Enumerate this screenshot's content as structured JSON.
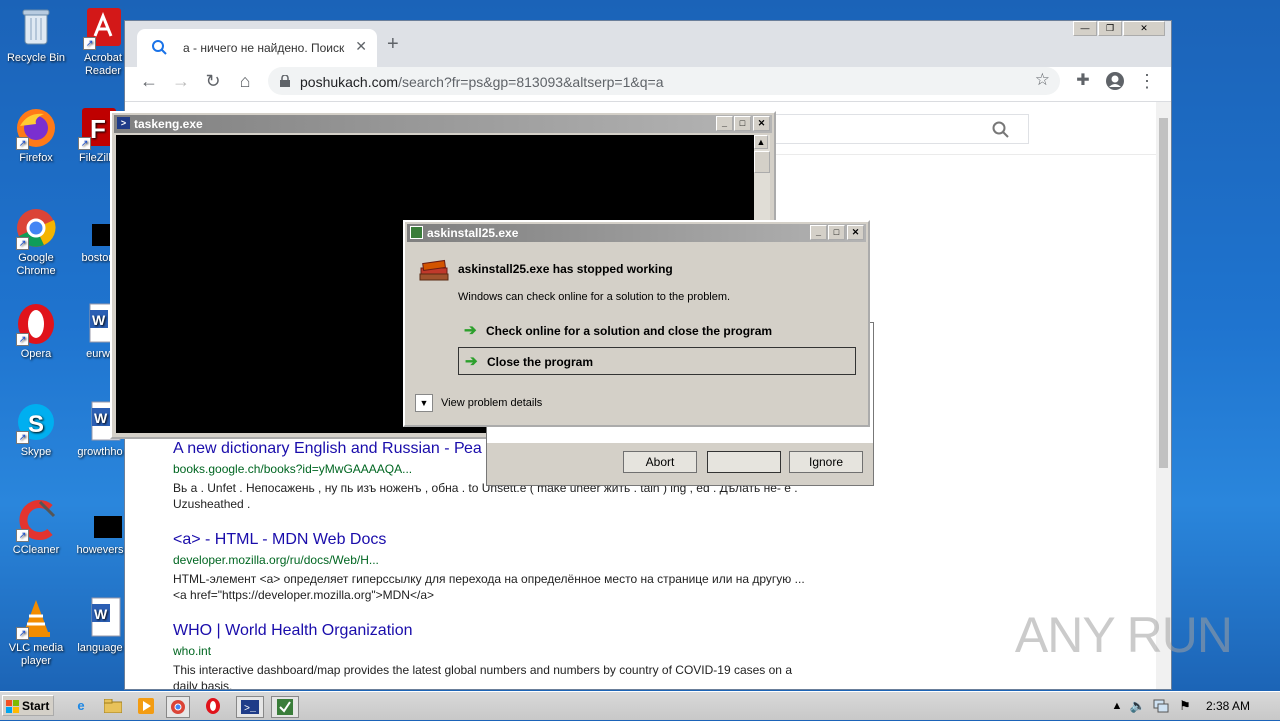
{
  "desktop": {
    "icons": [
      {
        "label": "Recycle Bin",
        "name": "recycle-bin-icon"
      },
      {
        "label": "Acrobat Reader",
        "name": "acrobat-reader-icon"
      },
      {
        "label": "Firefox",
        "name": "firefox-icon"
      },
      {
        "label": "FileZilla",
        "name": "filezilla-icon"
      },
      {
        "label": "Google Chrome",
        "name": "google-chrome-icon"
      },
      {
        "label": "boston",
        "name": "black-file-icon"
      },
      {
        "label": "Opera",
        "name": "opera-icon"
      },
      {
        "label": "eurw",
        "name": "word-document-icon"
      },
      {
        "label": "Skype",
        "name": "skype-icon"
      },
      {
        "label": "growthho",
        "name": "word-document-icon"
      },
      {
        "label": "CCleaner",
        "name": "ccleaner-icon"
      },
      {
        "label": "howevers",
        "name": "black-file-icon"
      },
      {
        "label": "VLC media player",
        "name": "vlc-icon"
      },
      {
        "label": "language",
        "name": "word-document-icon"
      }
    ]
  },
  "browser": {
    "tab_title": "а - ничего не найдено. Поиск",
    "url_host": "poshukach.com",
    "url_path": "/search?fr=ps&gp=813093&altserp=1&q=a",
    "results": [
      {
        "title": "A new dictionary English and Russian - Реа",
        "url": "books.google.ch/books?id=yMwGAAAAQA...",
        "snippet": "Вь а . Unfet . Непосажень , ну пь изъ ноженъ , обна . to Unsett.e ( make uneer жить . tain ) ing , еd . Дѣлать не- е . Uzusheathed ."
      },
      {
        "title": "<a> - HTML - MDN Web Docs",
        "url": "developer.mozilla.org/ru/docs/Web/H...",
        "snippet": "HTML-элемент <a> определяет гиперссылку для перехода на определённое место на странице или на другую ... <a href=\"https://developer.mozilla.org\">MDN</a>"
      },
      {
        "title": "WHO | World Health Organization",
        "url": "who.int",
        "snippet": "This interactive dashboard/map provides the latest global numbers and numbers by country of COVID-19 cases on a daily basis."
      }
    ]
  },
  "console": {
    "title": "taskeng.exe"
  },
  "msgbox": {
    "abort": "Abort",
    "retry": "",
    "ignore": "Ignore"
  },
  "wer": {
    "title": "askinstall25.exe",
    "heading": "askinstall25.exe has stopped working",
    "subtitle": "Windows can check online for a solution to the problem.",
    "option_check": "Check online for a solution and close the program",
    "option_close": "Close the program",
    "details": "View problem details"
  },
  "taskbar": {
    "start": "Start",
    "clock": "2:38 AM"
  },
  "watermark": "ANY RUN"
}
